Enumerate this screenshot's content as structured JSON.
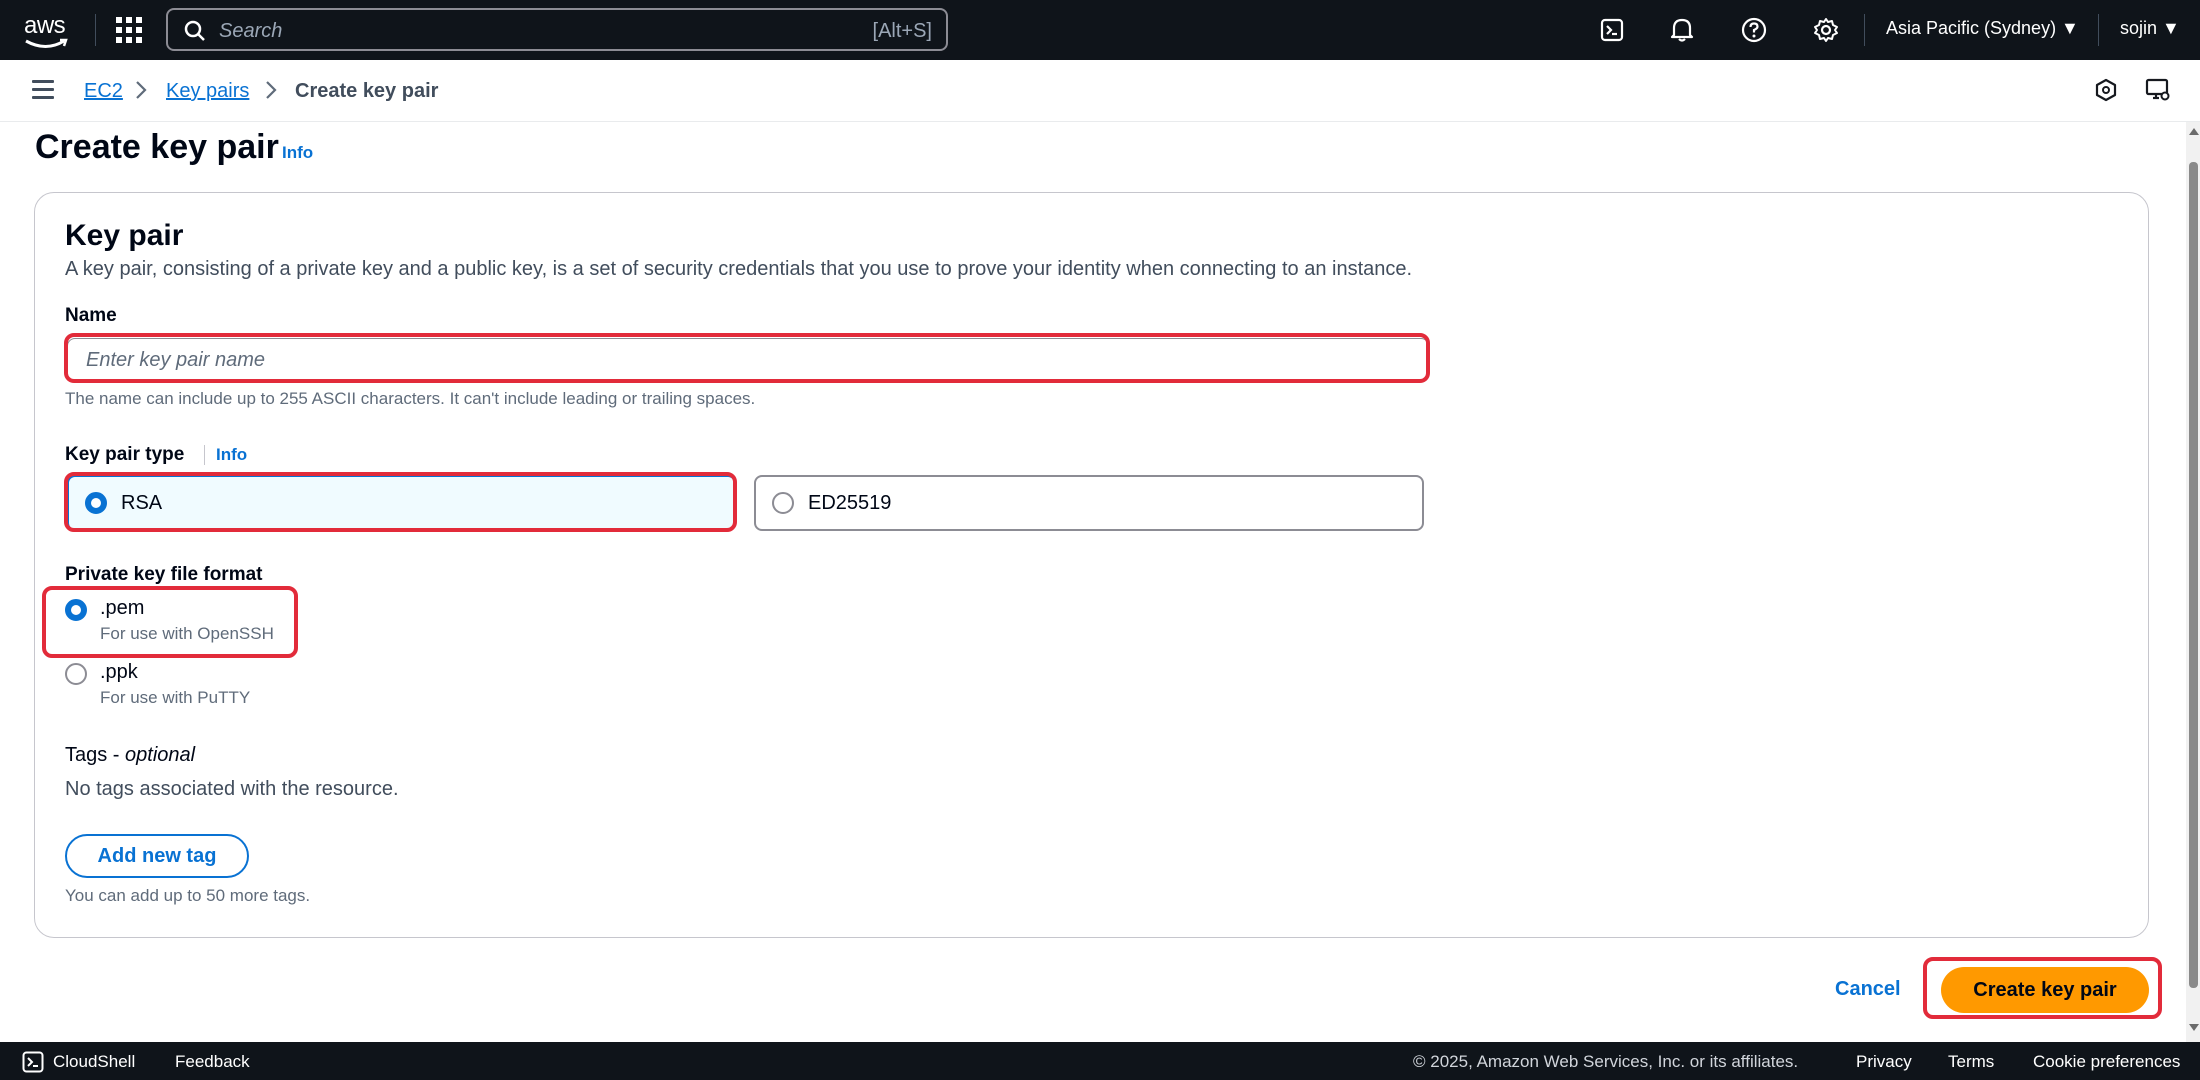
{
  "topnav": {
    "logo_text": "aws",
    "search_placeholder": "Search",
    "search_shortcut": "[Alt+S]",
    "region": "Asia Pacific (Sydney) ▼",
    "user": "sojin ▼"
  },
  "breadcrumb": {
    "items": [
      "EC2",
      "Key pairs"
    ],
    "current": "Create key pair"
  },
  "page": {
    "title": "Create key pair",
    "info": "Info"
  },
  "card": {
    "title": "Key pair",
    "description": "A key pair, consisting of a private key and a public key, is a set of security credentials that you use to prove your identity when connecting to an instance.",
    "name_label": "Name",
    "name_placeholder": "Enter key pair name",
    "name_value": "",
    "name_hint": "The name can include up to 255 ASCII characters. It can't include leading or trailing spaces.",
    "type_label": "Key pair type",
    "type_info": "Info",
    "type_options": [
      {
        "label": "RSA",
        "selected": true
      },
      {
        "label": "ED25519",
        "selected": false
      }
    ],
    "format_label": "Private key file format",
    "format_options": [
      {
        "label": ".pem",
        "sub": "For use with OpenSSH",
        "selected": true
      },
      {
        "label": ".ppk",
        "sub": "For use with PuTTY",
        "selected": false
      }
    ],
    "tags_label": "Tags - ",
    "tags_optional": "optional",
    "tags_none": "No tags associated with the resource.",
    "add_tag_button": "Add new tag",
    "tags_hint": "You can add up to 50 more tags."
  },
  "actions": {
    "cancel": "Cancel",
    "create": "Create key pair"
  },
  "footer": {
    "cloudshell": "CloudShell",
    "feedback": "Feedback",
    "copyright": "© 2025, Amazon Web Services, Inc. or its affiliates.",
    "privacy": "Privacy",
    "terms": "Terms",
    "cookies": "Cookie preferences"
  },
  "colors": {
    "nav_bg": "#0f141a",
    "link": "#0972d3",
    "primary_button": "#ff9900",
    "highlight": "#e22b3a"
  }
}
